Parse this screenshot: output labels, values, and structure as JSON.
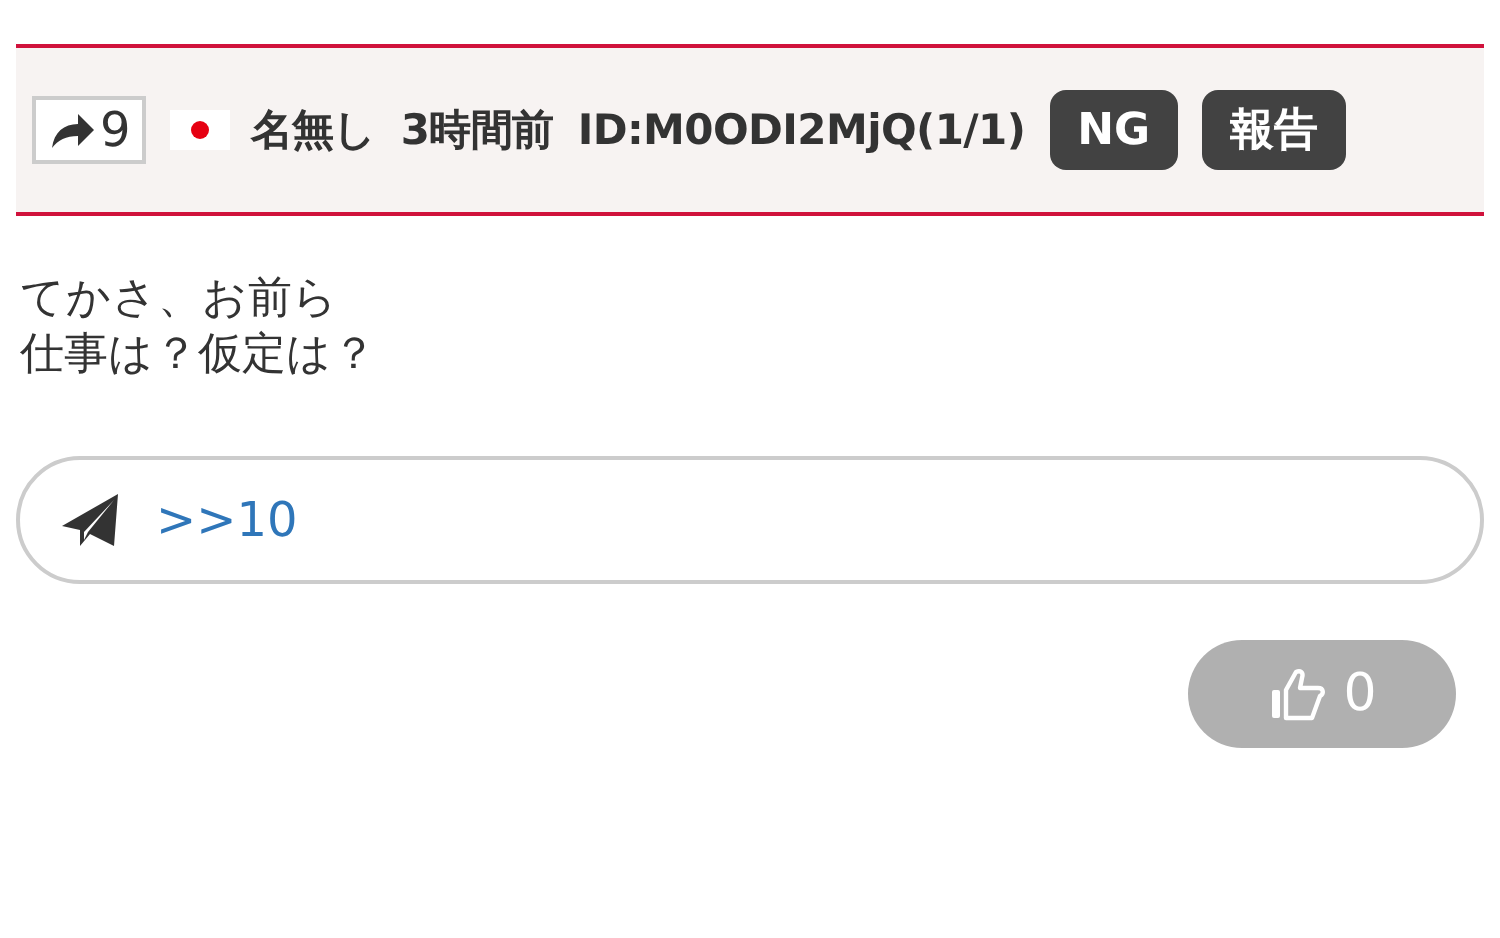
{
  "post_header": {
    "share_count": "9",
    "name": "名無し",
    "time": "3時間前",
    "id": "ID:M0ODI2MjQ(1/1)",
    "buttons": [
      "NG",
      "報告"
    ]
  },
  "body": [
    "てかさ、お前ら",
    "仕事は？仮定は？"
  ],
  "reply": {
    "value": ">>10"
  },
  "like": {
    "count": "0"
  }
}
